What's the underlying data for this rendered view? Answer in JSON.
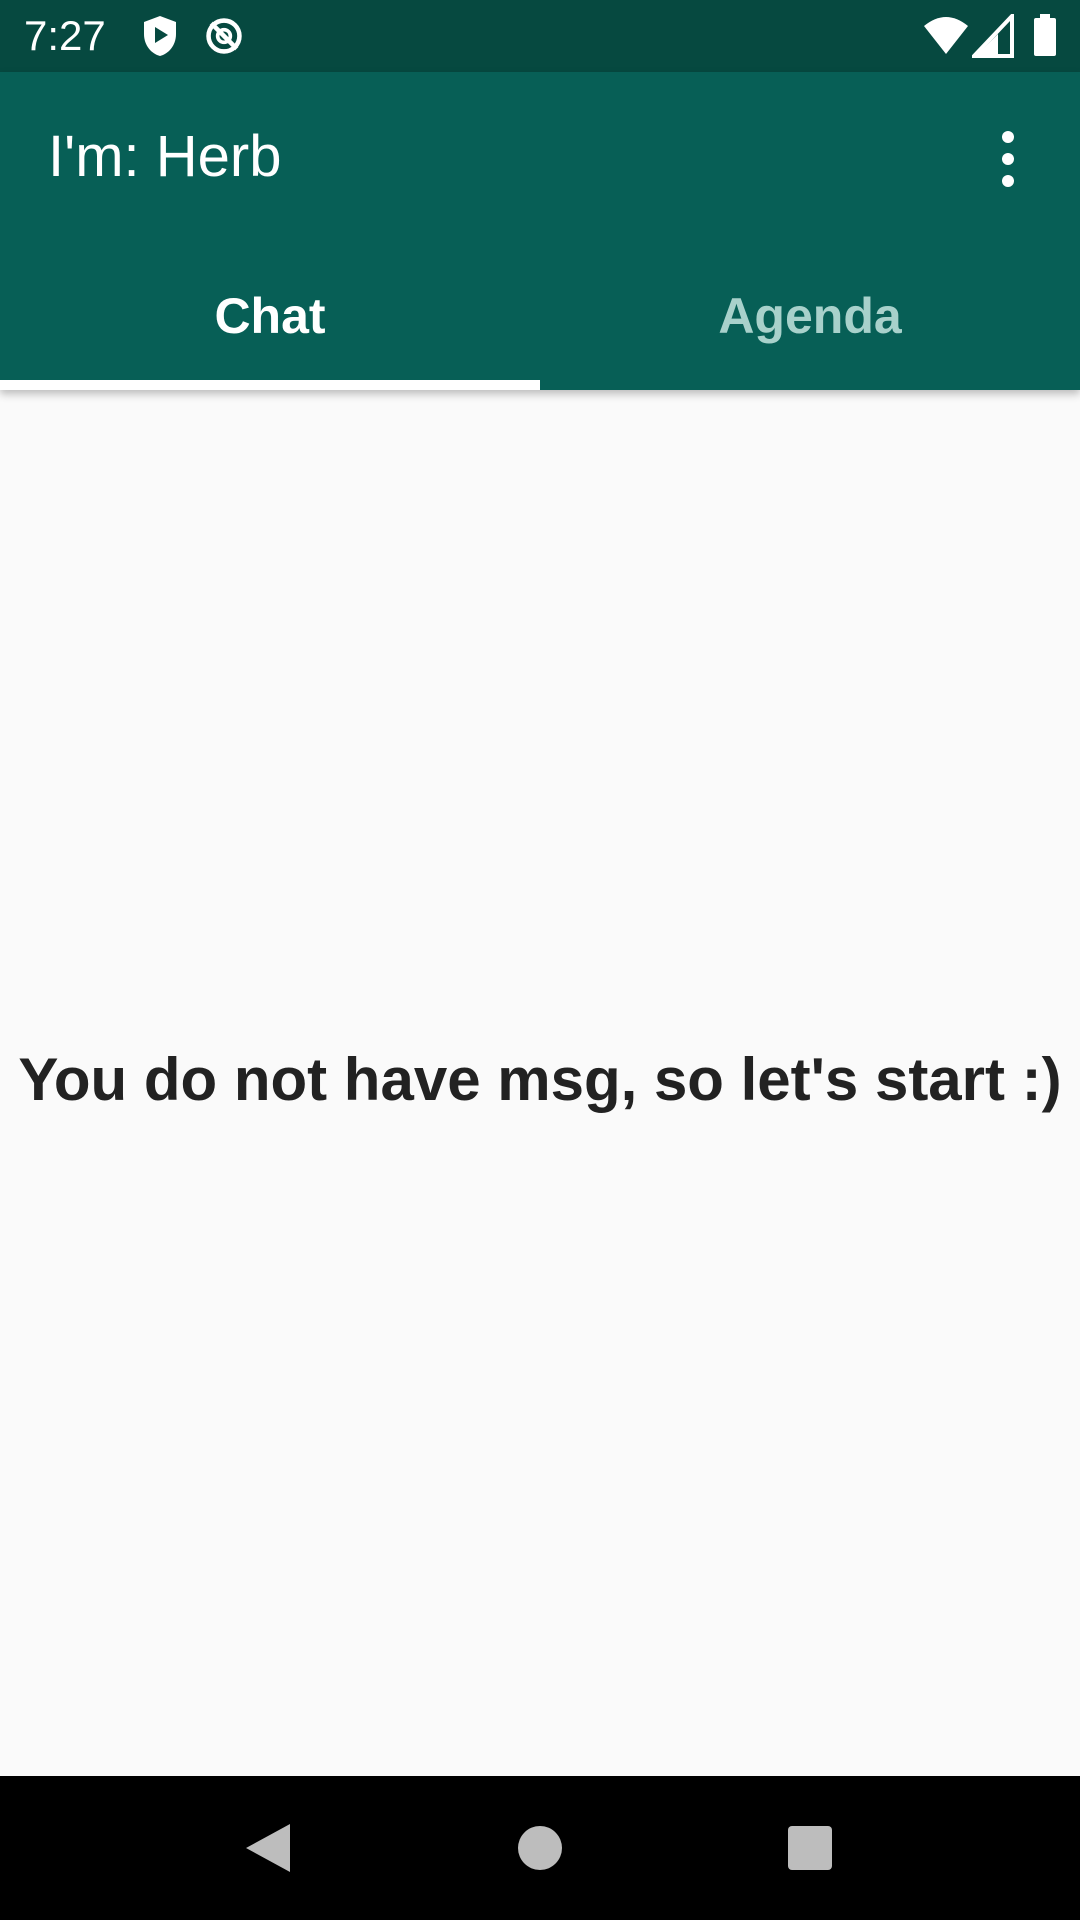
{
  "status": {
    "time": "7:27"
  },
  "app_bar": {
    "title": "I'm: Herb"
  },
  "tabs": [
    {
      "label": "Chat",
      "selected": true
    },
    {
      "label": "Agenda",
      "selected": false
    }
  ],
  "main": {
    "empty_message": "You do not have msg, so let's start :)"
  },
  "icons": {
    "status_left": [
      "shield-play-icon",
      "no-disturb-icon"
    ],
    "status_right": [
      "wifi-icon",
      "cell-signal-icon",
      "battery-icon"
    ],
    "app_bar": [
      "overflow-menu-icon"
    ],
    "nav": [
      "back-icon",
      "home-icon",
      "recents-icon"
    ]
  },
  "colors": {
    "status_bar": "#064940",
    "app_bar": "#075f56",
    "tab_selected": "#ffffff",
    "tab_unselected": "#a8d1cb",
    "background": "#fafafa",
    "nav_bar": "#000000"
  }
}
